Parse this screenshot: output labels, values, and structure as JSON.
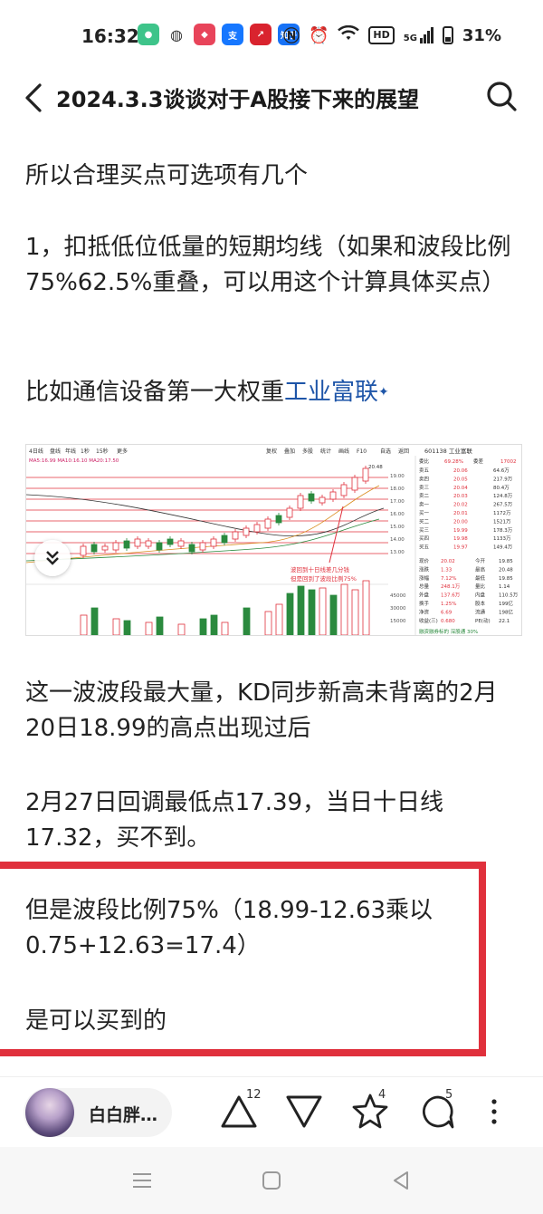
{
  "status_bar": {
    "time": "16:32",
    "network": "5G",
    "battery": "31%",
    "hd_label": "HD",
    "app_icons": [
      "chat-bubble-icon",
      "wechat-icon",
      "gift-app-icon",
      "alipay-icon",
      "stock-app-icon",
      "zhihu-icon"
    ],
    "zhihu_label": "知乎",
    "sys_icons": [
      "nfc-icon",
      "alarm-icon",
      "wifi-icon",
      "signal-icon",
      "battery-icon"
    ]
  },
  "header": {
    "title": "2024.3.3谈谈对于A股接下来的展望"
  },
  "article": {
    "p1": "所以合理买点可选项有几个",
    "p2": "1，扣抵低位低量的短期均线（如果和波段比例75%62.5%重叠，可以用这个计算具体买点）",
    "p3_prefix": "比如通信设备第一大权重",
    "p3_link": "工业富联",
    "p4": "这一波波段最大量，KD同步新高未背离的2月20日18.99的高点出现过后",
    "p5": "2月27日回调最低点17.39，当日十日线17.32，买不到。",
    "p6": "但是波段比例75%（18.99-12.63乘以0.75+12.63=17.4）",
    "p7": "是可以买到的"
  },
  "chart": {
    "toolbar": [
      "4日线",
      "盘线",
      "年线",
      "1秒",
      "15秒",
      "更多"
    ],
    "toolbar_right": [
      "复权",
      "叠加",
      "多股",
      "统计",
      "画线",
      "F10",
      "自选",
      "返回"
    ],
    "ma_legend": "MA5:16.99 MA10:16.10 MA20:17.50",
    "stock_code": "601138 工业富联",
    "peak_label": "20.48",
    "annotation_line1": "波回到十日线差几分钱",
    "annotation_line2": "但是回到了波段比例75%",
    "price_ticks": [
      "19.00",
      "18.00",
      "17.00",
      "16.00",
      "15.00",
      "14.00",
      "13.00"
    ],
    "volume_ticks": [
      "45000",
      "30000",
      "15000"
    ],
    "quote_header": [
      "委比",
      "69.28%",
      "委差",
      "17002"
    ],
    "quote_rows": [
      [
        "卖五",
        "20.06",
        "64.6万"
      ],
      [
        "卖四",
        "20.05",
        "217.9万"
      ],
      [
        "卖三",
        "20.04",
        "80.4万"
      ],
      [
        "卖二",
        "20.03",
        "124.8万"
      ],
      [
        "卖一",
        "20.02",
        "267.5万"
      ],
      [
        "买一",
        "20.01",
        "1172万"
      ],
      [
        "买二",
        "20.00",
        "1521万"
      ],
      [
        "买三",
        "19.99",
        "178.3万"
      ],
      [
        "买四",
        "19.98",
        "1133万"
      ],
      [
        "买五",
        "19.97",
        "149.4万"
      ]
    ],
    "stats_rows": [
      [
        "现价",
        "20.02",
        "今开",
        "19.85"
      ],
      [
        "涨跌",
        "1.33",
        "最高",
        "20.48"
      ],
      [
        "涨幅",
        "7.12%",
        "最低",
        "19.85"
      ],
      [
        "总量",
        "248.1万",
        "量比",
        "1.14"
      ],
      [
        "外盘",
        "137.6万",
        "内盘",
        "110.5万"
      ],
      [
        "换手",
        "1.25%",
        "股本",
        "199亿"
      ],
      [
        "净资",
        "6.69",
        "流通",
        "198亿"
      ],
      [
        "收益(三)",
        "0.680",
        "PE(动)",
        "22.1"
      ]
    ],
    "bottom_note": "融资融券标的 深股通 30%"
  },
  "action_bar": {
    "author_name": "白白胖…",
    "like_count": "12",
    "favorite_count": "4",
    "comment_count": "5"
  },
  "colors": {
    "highlight_border": "#e0303c",
    "link": "#1e55a8",
    "up_candle": "#e0303c",
    "down_candle": "#2b8a3e"
  }
}
